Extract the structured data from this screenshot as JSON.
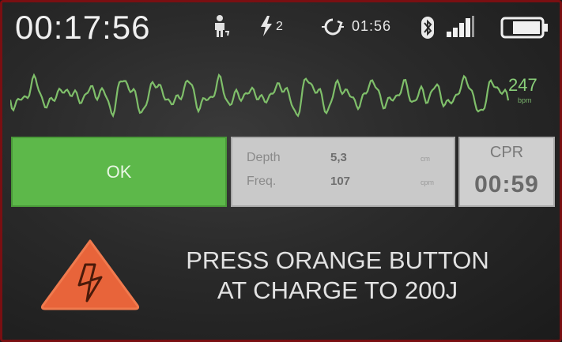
{
  "status_bar": {
    "time": "00:17:56",
    "shock_count": "2",
    "cpr_timer": "01:56",
    "icons": [
      "person-icon",
      "flash-icon",
      "timer-icon",
      "bluetooth-icon",
      "signal-icon",
      "battery-icon"
    ]
  },
  "ecg": {
    "heart_rate": "247",
    "heart_rate_unit": "bpm",
    "trace_color": "#7fbf6a"
  },
  "ok_panel": {
    "label": "OK",
    "color": "#5db84a"
  },
  "cpr_stats": {
    "depth_label": "Depth",
    "depth_value": "5,3",
    "depth_unit": "cm",
    "freq_label": "Freq.",
    "freq_value": "107",
    "freq_unit": "cpm"
  },
  "cpr_panel": {
    "title": "CPR",
    "time": "00:59"
  },
  "warning": {
    "line1": "PRESS ORANGE BUTTON",
    "line2": "AT CHARGE TO 200J",
    "icon": "high-voltage-warning-icon",
    "icon_color": "#e8643a"
  }
}
